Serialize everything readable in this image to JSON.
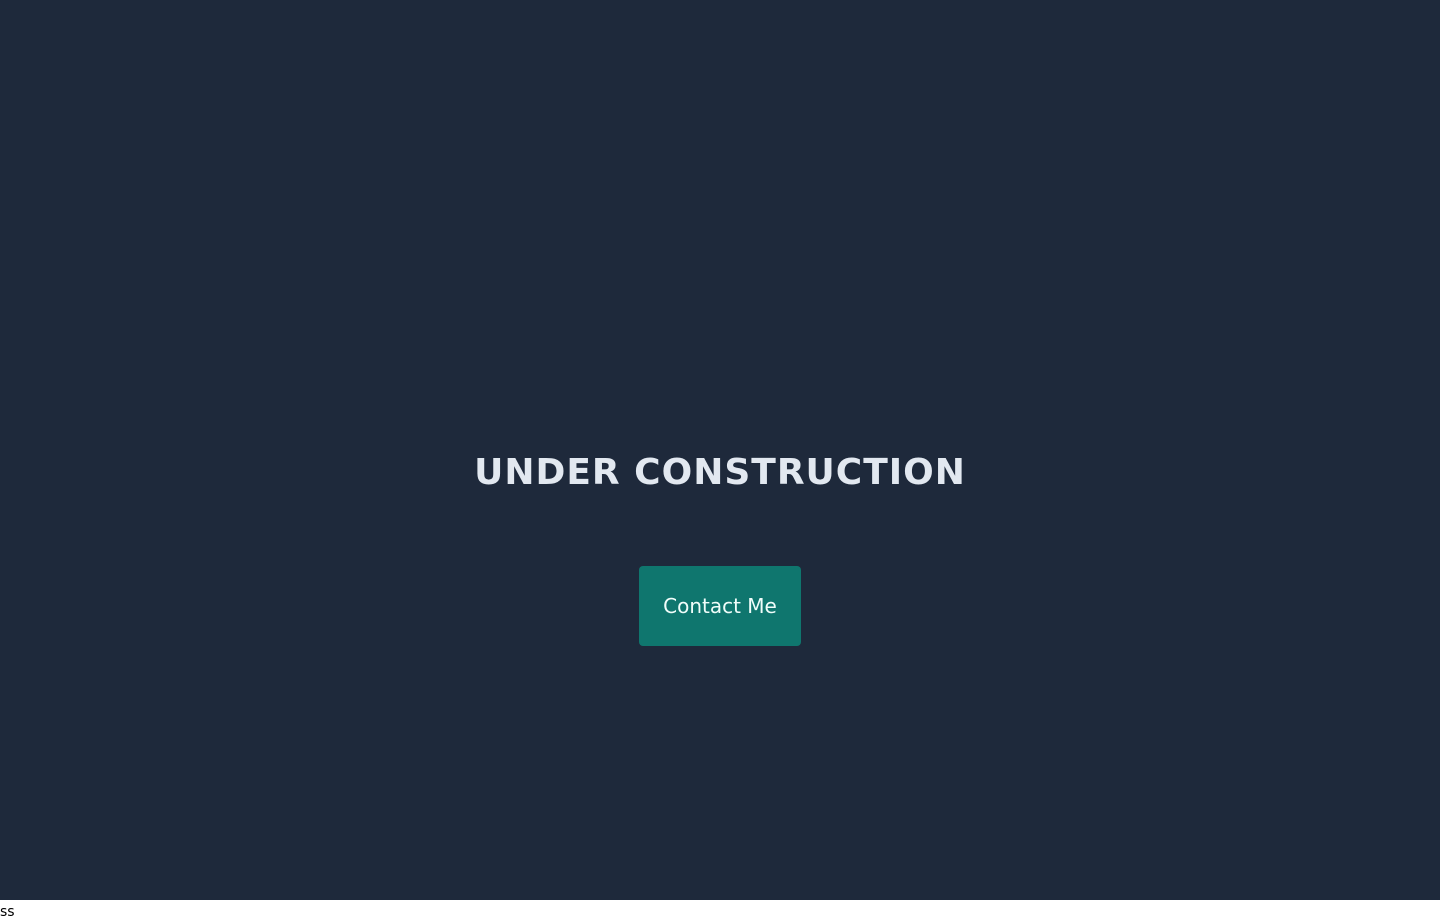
{
  "hero": {
    "title": "UNDER CONSTRUCTION",
    "contact_button_label": "Contact Me"
  },
  "footer": {
    "text": "ss"
  },
  "colors": {
    "background": "#1e293b",
    "title": "#e2e8f0",
    "button_background": "#0f766e",
    "button_text": "#f0fdfa",
    "page_background": "#ffffff"
  }
}
